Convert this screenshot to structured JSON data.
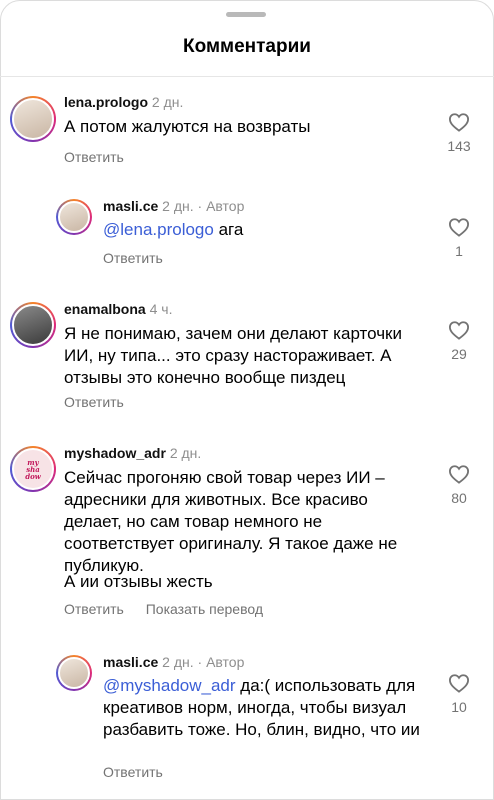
{
  "header": {
    "title": "Комментарии"
  },
  "labels": {
    "reply": "Ответить",
    "translate": "Показать перевод"
  },
  "comments": [
    {
      "user": "lena.prologo",
      "time": "2 дн.",
      "author_tag": "",
      "mention": "",
      "text": "А потом жалуются на возвраты",
      "extra": "",
      "likes": "143",
      "avatar_icon": "profile-photo"
    },
    {
      "user": "masli.ce",
      "time": "2 дн.",
      "author_tag": "Автор",
      "mention": "@lena.prologo",
      "text": " ага",
      "extra": "",
      "likes": "1",
      "avatar_icon": "profile-photo"
    },
    {
      "user": "enamalbona",
      "time": "4 ч.",
      "author_tag": "",
      "mention": "",
      "text": "Я не понимаю, зачем они делают карточки ИИ, ну типа... это сразу настораживает. А отзывы это конечно вообще пиздец",
      "extra": "",
      "likes": "29",
      "avatar_icon": "profile-photo"
    },
    {
      "user": "myshadow_adr",
      "time": "2 дн.",
      "author_tag": "",
      "mention": "",
      "text": "Сейчас прогоняю свой товар через ИИ – адресники для животных. Все красиво делает, но сам товар немного не соответствует оригиналу. Я такое даже не публикую.",
      "extra": "А ии отзывы жесть",
      "likes": "80",
      "avatar_icon": "brand-logo",
      "logo_lines": [
        "my",
        "sha",
        "dow"
      ]
    },
    {
      "user": "masli.ce",
      "time": "2 дн.",
      "author_tag": "Автор",
      "mention": "@myshadow_adr",
      "text": " да:( использовать для креативов норм, иногда, чтобы визуал разбавить тоже. Но, блин, видно, что ии",
      "extra": "",
      "likes": "10",
      "avatar_icon": "profile-photo"
    }
  ],
  "colors": {
    "mention": "#3b5ed6",
    "secondary": "#737373",
    "ring": "#dd2a7b"
  }
}
